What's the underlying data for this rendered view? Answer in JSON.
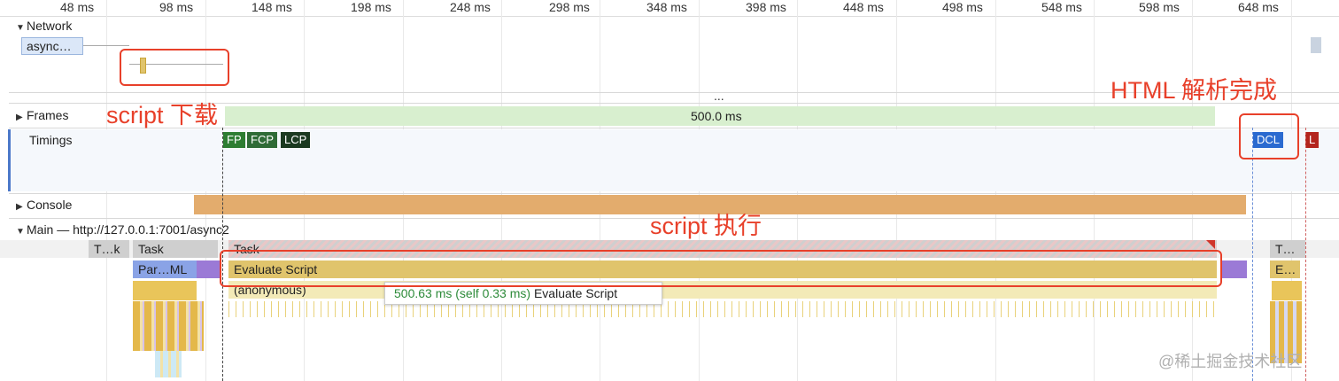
{
  "ruler_ticks": [
    "48 ms",
    "98 ms",
    "148 ms",
    "198 ms",
    "248 ms",
    "298 ms",
    "348 ms",
    "398 ms",
    "448 ms",
    "498 ms",
    "548 ms",
    "598 ms",
    "648 ms"
  ],
  "network": {
    "label": "Network",
    "request_label": "async…"
  },
  "overview_more": "...",
  "frames": {
    "label": "Frames",
    "duration": "500.0 ms"
  },
  "timings": {
    "label": "Timings",
    "markers": [
      "FP",
      "FCP",
      "LCP",
      "DCL",
      "L"
    ]
  },
  "console": {
    "label": "Console"
  },
  "main": {
    "label": "Main — http://127.0.0.1:7001/async2",
    "tasks": [
      "T…k",
      "Task",
      "Task",
      "T…"
    ],
    "parse_html": "Par…ML",
    "evaluate_script": "Evaluate Script",
    "evaluate_script_short": "E…",
    "anonymous": "(anonymous)"
  },
  "tooltip": {
    "time": "500.63 ms (self 0.33 ms)",
    "name": "Evaluate Script"
  },
  "annotations": {
    "download": "script 下载",
    "execute": "script 执行",
    "parse_done": "HTML 解析完成"
  },
  "watermark": "@稀土掘金技术社区",
  "colors": {
    "annotation_red": "#e8402a",
    "script_yellow": "#e0c46c",
    "console_orange": "#e3ac6d",
    "frames_green": "#d8efcf",
    "dcl_blue": "#2a6ad0",
    "fp_green": "#2e7d32",
    "lcp_dark": "#1b3a20",
    "load_red": "#b3261e"
  }
}
